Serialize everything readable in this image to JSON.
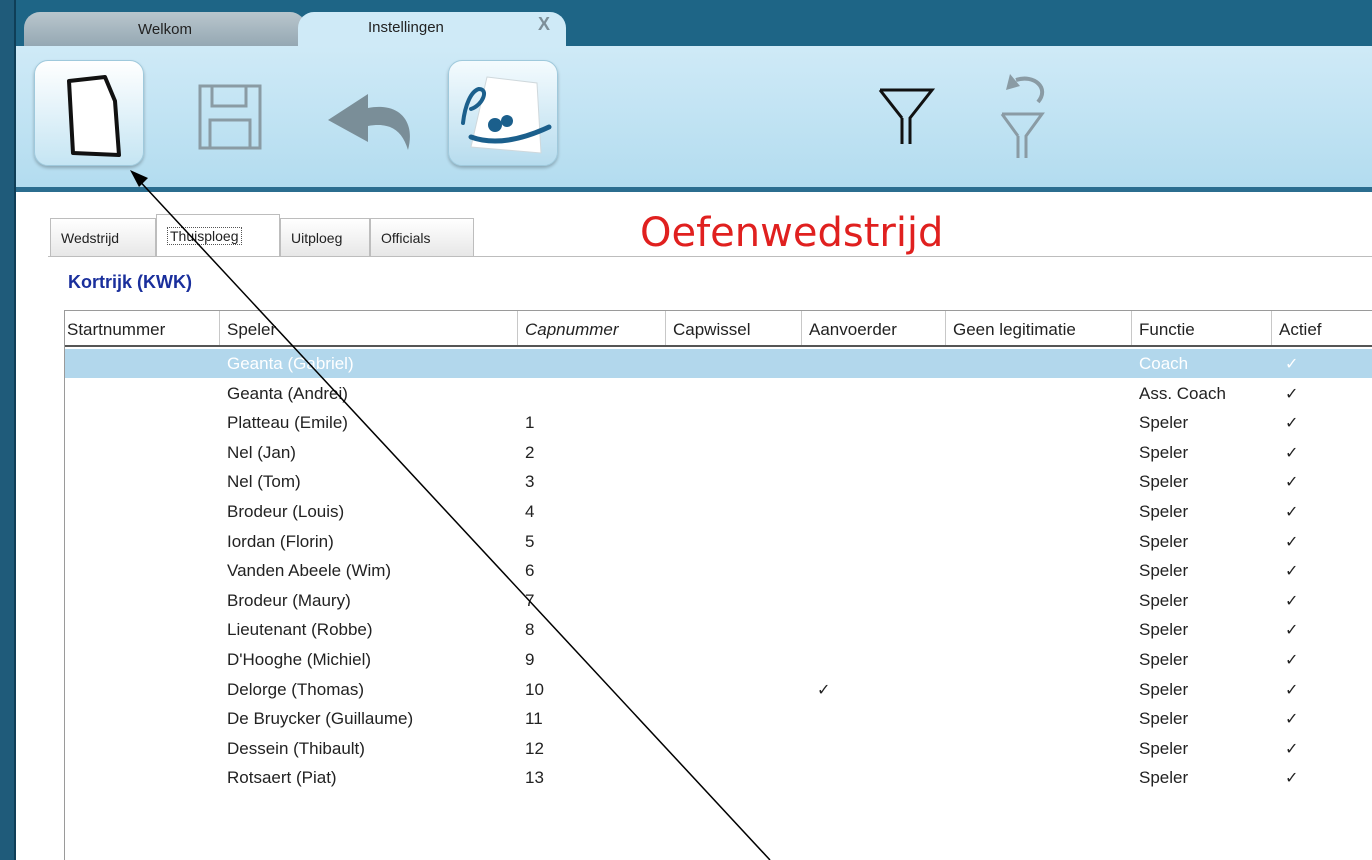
{
  "tabs": [
    {
      "label": "Welkom"
    },
    {
      "label": "Instellingen",
      "close": "X"
    }
  ],
  "toolbar": {
    "buttons": [
      {
        "name": "new-document",
        "icon": "new-document-icon"
      },
      {
        "name": "save",
        "icon": "floppy-disk-icon"
      },
      {
        "name": "undo",
        "icon": "undo-arrow-icon"
      },
      {
        "name": "team",
        "icon": "team-swimmer-icon"
      },
      {
        "name": "filter",
        "icon": "funnel-icon"
      },
      {
        "name": "filter-reset",
        "icon": "funnel-reset-icon"
      }
    ]
  },
  "subtabs": [
    "Wedstrijd",
    "Thuisploeg",
    "Uitploeg",
    "Officials"
  ],
  "match_title": "Oefenwedstrijd",
  "team_name": "Kortrijk (KWK)",
  "table": {
    "columns": [
      "Startnummer",
      "Speler",
      "Capnummer",
      "Capwissel",
      "Aanvoerder",
      "Geen legitimatie",
      "Functie",
      "Actief"
    ],
    "rows": [
      {
        "startnummer": "",
        "speler": "Geanta (Gabriel)",
        "capnummer": "",
        "capwissel": "",
        "aanvoerder": "",
        "geen_legitimatie": "",
        "functie": "Coach",
        "actief": "✓",
        "selected": true
      },
      {
        "startnummer": "",
        "speler": "Geanta (Andrei)",
        "capnummer": "",
        "capwissel": "",
        "aanvoerder": "",
        "geen_legitimatie": "",
        "functie": "Ass. Coach",
        "actief": "✓"
      },
      {
        "startnummer": "",
        "speler": "Platteau (Emile)",
        "capnummer": "1",
        "capwissel": "",
        "aanvoerder": "",
        "geen_legitimatie": "",
        "functie": "Speler",
        "actief": "✓"
      },
      {
        "startnummer": "",
        "speler": "Nel (Jan)",
        "capnummer": "2",
        "capwissel": "",
        "aanvoerder": "",
        "geen_legitimatie": "",
        "functie": "Speler",
        "actief": "✓"
      },
      {
        "startnummer": "",
        "speler": "Nel (Tom)",
        "capnummer": "3",
        "capwissel": "",
        "aanvoerder": "",
        "geen_legitimatie": "",
        "functie": "Speler",
        "actief": "✓"
      },
      {
        "startnummer": "",
        "speler": "Brodeur (Louis)",
        "capnummer": "4",
        "capwissel": "",
        "aanvoerder": "",
        "geen_legitimatie": "",
        "functie": "Speler",
        "actief": "✓"
      },
      {
        "startnummer": "",
        "speler": "Iordan (Florin)",
        "capnummer": "5",
        "capwissel": "",
        "aanvoerder": "",
        "geen_legitimatie": "",
        "functie": "Speler",
        "actief": "✓"
      },
      {
        "startnummer": "",
        "speler": "Vanden Abeele (Wim)",
        "capnummer": "6",
        "capwissel": "",
        "aanvoerder": "",
        "geen_legitimatie": "",
        "functie": "Speler",
        "actief": "✓"
      },
      {
        "startnummer": "",
        "speler": "Brodeur (Maury)",
        "capnummer": "7",
        "capwissel": "",
        "aanvoerder": "",
        "geen_legitimatie": "",
        "functie": "Speler",
        "actief": "✓"
      },
      {
        "startnummer": "",
        "speler": "Lieutenant (Robbe)",
        "capnummer": "8",
        "capwissel": "",
        "aanvoerder": "",
        "geen_legitimatie": "",
        "functie": "Speler",
        "actief": "✓"
      },
      {
        "startnummer": "",
        "speler": "D'Hooghe (Michiel)",
        "capnummer": "9",
        "capwissel": "",
        "aanvoerder": "",
        "geen_legitimatie": "",
        "functie": "Speler",
        "actief": "✓"
      },
      {
        "startnummer": "",
        "speler": "Delorge (Thomas)",
        "capnummer": "10",
        "capwissel": "",
        "aanvoerder": "✓",
        "geen_legitimatie": "",
        "functie": "Speler",
        "actief": "✓"
      },
      {
        "startnummer": "",
        "speler": "De Bruycker (Guillaume)",
        "capnummer": "11",
        "capwissel": "",
        "aanvoerder": "",
        "geen_legitimatie": "",
        "functie": "Speler",
        "actief": "✓"
      },
      {
        "startnummer": "",
        "speler": "Dessein (Thibault)",
        "capnummer": "12",
        "capwissel": "",
        "aanvoerder": "",
        "geen_legitimatie": "",
        "functie": "Speler",
        "actief": "✓"
      },
      {
        "startnummer": "",
        "speler": "Rotsaert (Piat)",
        "capnummer": "13",
        "capwissel": "",
        "aanvoerder": "",
        "geen_legitimatie": "",
        "functie": "Speler",
        "actief": "✓"
      }
    ]
  },
  "colors": {
    "title_red": "#e0201f",
    "team_blue": "#1a2f9c",
    "selected_row": "#b2d7ec",
    "frame_blue": "#1e6586"
  }
}
